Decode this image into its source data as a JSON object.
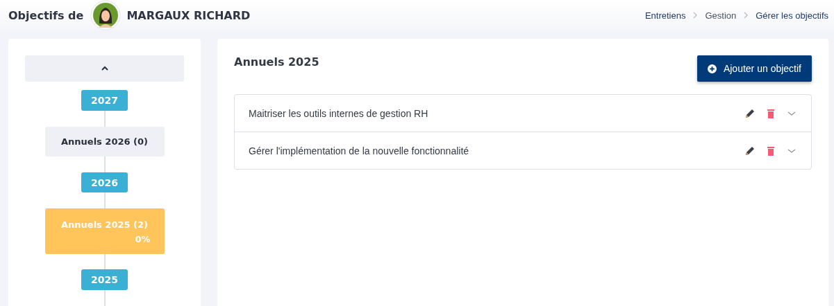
{
  "header": {
    "title": "Objectifs de",
    "person": "MARGAUX RICHARD"
  },
  "breadcrumb": [
    {
      "label": "Entretiens",
      "link": true
    },
    {
      "label": "Gestion",
      "link": false
    },
    {
      "label": "Gérer les objectifs",
      "link": true
    }
  ],
  "timeline": [
    {
      "kind": "year",
      "label": "2027"
    },
    {
      "kind": "period",
      "label": "Annuels 2026 (0)",
      "selected": false
    },
    {
      "kind": "year",
      "label": "2026"
    },
    {
      "kind": "period",
      "label": "Annuels 2025 (2)",
      "selected": true,
      "progress": "0%"
    },
    {
      "kind": "year",
      "label": "2025"
    }
  ],
  "main": {
    "title": "Annuels 2025",
    "add_button": "Ajouter un objectif",
    "objectives": [
      {
        "title": "Maitriser les outils internes de gestion RH"
      },
      {
        "title": "Gérer l'implémentation de la nouvelle fonctionnalité"
      }
    ]
  }
}
